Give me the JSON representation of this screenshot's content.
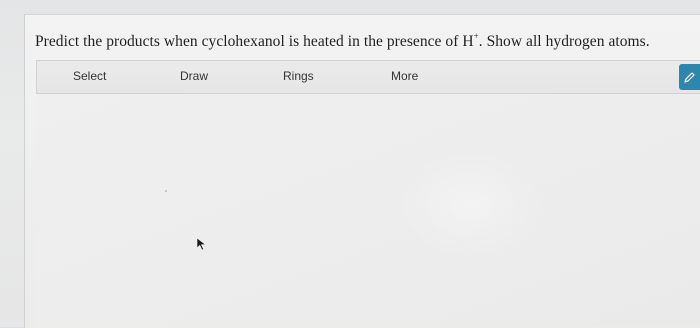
{
  "question": {
    "text_before": "Predict the products when cyclohexanol is heated in the presence of H",
    "superscript": "+",
    "text_after": ". Show all hydrogen atoms."
  },
  "toolbar": {
    "items": [
      {
        "label": "Select"
      },
      {
        "label": "Draw"
      },
      {
        "label": "Rings"
      },
      {
        "label": "More"
      }
    ]
  },
  "colors": {
    "side_tab": "#2e86ad"
  },
  "icons": {
    "side_tab": "pencil-icon",
    "cursor": "arrow-cursor-icon"
  }
}
